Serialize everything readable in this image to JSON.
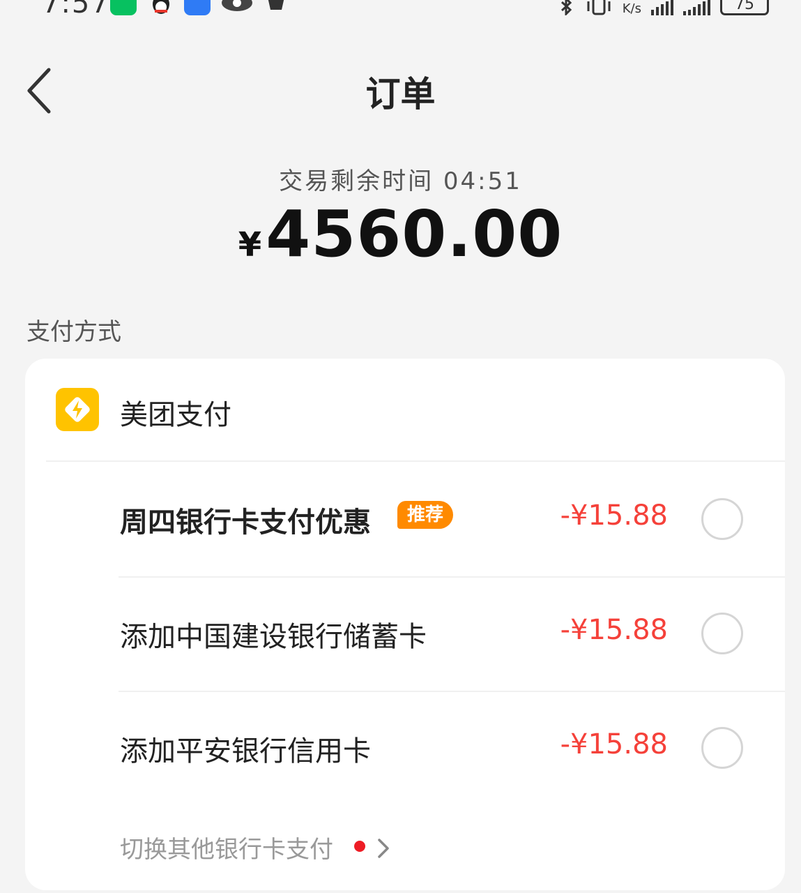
{
  "status_bar": {
    "time": "7:57",
    "net_speed_unit": "K/s",
    "battery": "75"
  },
  "nav": {
    "title": "订单"
  },
  "order": {
    "timer": "交易剩余时间 04:51",
    "currency": "¥",
    "amount": "4560.00"
  },
  "payment": {
    "section_label": "支付方式",
    "provider": "美团支付",
    "options": [
      {
        "label": "周四银行卡支付优惠",
        "badge": "推荐",
        "discount": "-¥15.88",
        "selected": false
      },
      {
        "label": "添加中国建设银行储蓄卡",
        "discount": "-¥15.88",
        "selected": false
      },
      {
        "label": "添加平安银行信用卡",
        "discount": "-¥15.88",
        "selected": false
      }
    ],
    "switch_label": "切换其他银行卡支付"
  },
  "colors": {
    "background": "#f4f4f4",
    "discount": "#f5413a",
    "badge": "#ff8a00",
    "meituan_yellow": "#ffc300"
  }
}
